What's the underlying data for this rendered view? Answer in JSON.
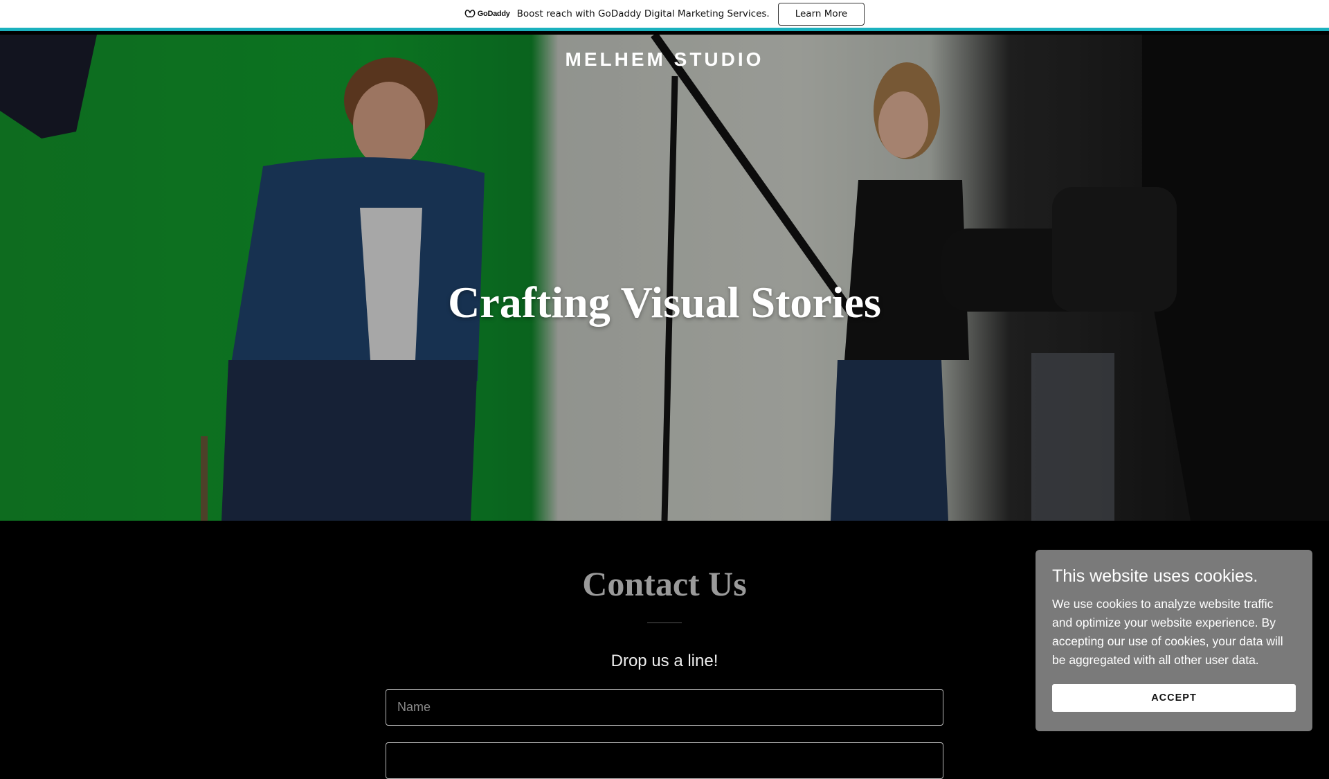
{
  "promo": {
    "logo_text": "GoDaddy",
    "message": "Boost reach with GoDaddy Digital Marketing Services.",
    "cta_label": "Learn More",
    "accent_color": "#1bb1be"
  },
  "hero": {
    "site_title": "MELHEM STUDIO",
    "heading": "Crafting Visual Stories"
  },
  "contact": {
    "title": "Contact Us",
    "subtitle": "Drop us a line!",
    "name_placeholder": "Name",
    "email_placeholder": ""
  },
  "cookie_banner": {
    "title": "This website uses cookies.",
    "text": "We use cookies to analyze website traffic and optimize your website experience. By accepting our use of cookies, your data will be aggregated with all other user data.",
    "accept_label": "ACCEPT"
  }
}
